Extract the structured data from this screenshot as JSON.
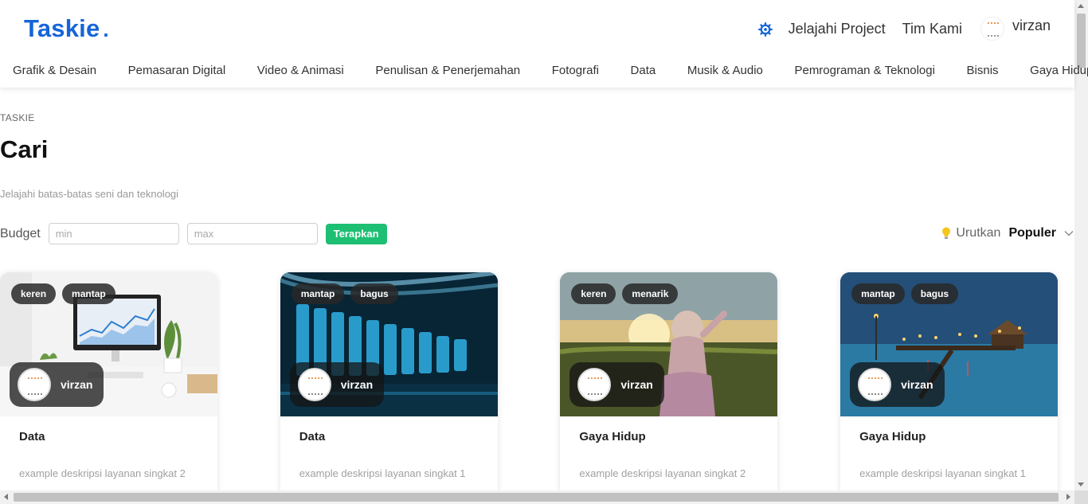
{
  "brand": {
    "name": "Taskie",
    "dot": ".",
    "color": "#1565d8"
  },
  "top_nav": {
    "settings_icon": "gear-icon",
    "links": [
      "Jelajahi Project",
      "Tim Kami"
    ],
    "user": {
      "name": "virzan"
    }
  },
  "categories": [
    "Grafik & Desain",
    "Pemasaran Digital",
    "Video & Animasi",
    "Penulisan & Penerjemahan",
    "Fotografi",
    "Data",
    "Musik & Audio",
    "Pemrograman & Teknologi",
    "Bisnis",
    "Gaya Hidup"
  ],
  "page": {
    "breadcrumb": "TASKIE",
    "title": "Cari",
    "subtitle": "Jelajahi batas-batas seni dan teknologi"
  },
  "filters": {
    "budget_label": "Budget",
    "min_placeholder": "min",
    "max_placeholder": "max",
    "apply_label": "Terapkan",
    "apply_color": "#1dbf73"
  },
  "sort": {
    "label": "Urutkan",
    "value": "Populer",
    "icon": "lightbulb-icon"
  },
  "cards": [
    {
      "tags": [
        "keren",
        "mantap"
      ],
      "seller": "virzan",
      "category": "Data",
      "description": "example deskripsi layanan singkat 2"
    },
    {
      "tags": [
        "mantap",
        "bagus"
      ],
      "seller": "virzan",
      "category": "Data",
      "description": "example deskripsi layanan singkat 1"
    },
    {
      "tags": [
        "keren",
        "menarik"
      ],
      "seller": "virzan",
      "category": "Gaya Hidup",
      "description": "example deskripsi layanan singkat 2"
    },
    {
      "tags": [
        "mantap",
        "bagus"
      ],
      "seller": "virzan",
      "category": "Gaya Hidup",
      "description": "example deskripsi layanan singkat 1"
    }
  ]
}
